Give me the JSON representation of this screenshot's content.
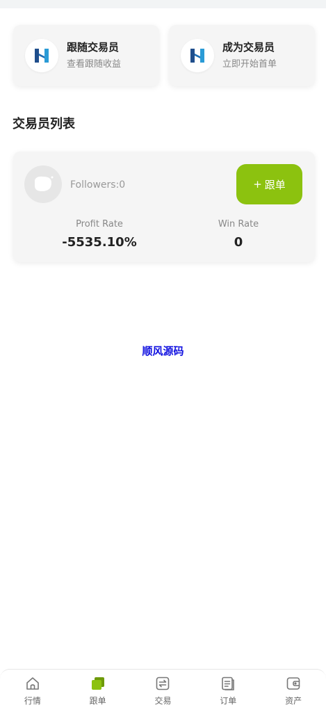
{
  "entries": [
    {
      "title": "跟随交易员",
      "subtitle": "查看跟随收益"
    },
    {
      "title": "成为交易员",
      "subtitle": "立即开始首单"
    }
  ],
  "section_title": "交易员列表",
  "trader": {
    "followers_text": "Followers:0",
    "follow_button_label": "跟单",
    "follow_button_plus": "+",
    "profit_rate_label": "Profit Rate",
    "profit_rate_value": "-5535.10%",
    "win_rate_label": "Win Rate",
    "win_rate_value": "0"
  },
  "watermark": "顺风源码",
  "tabs": [
    {
      "label": "行情",
      "icon": "home-icon"
    },
    {
      "label": "跟单",
      "icon": "copy-trade-icon",
      "active": true
    },
    {
      "label": "交易",
      "icon": "exchange-icon"
    },
    {
      "label": "订单",
      "icon": "orders-icon"
    },
    {
      "label": "资产",
      "icon": "wallet-icon"
    }
  ],
  "colors": {
    "accent": "#8cc20f",
    "logo_blue": "#1f6fb5",
    "watermark": "#1010e0"
  }
}
